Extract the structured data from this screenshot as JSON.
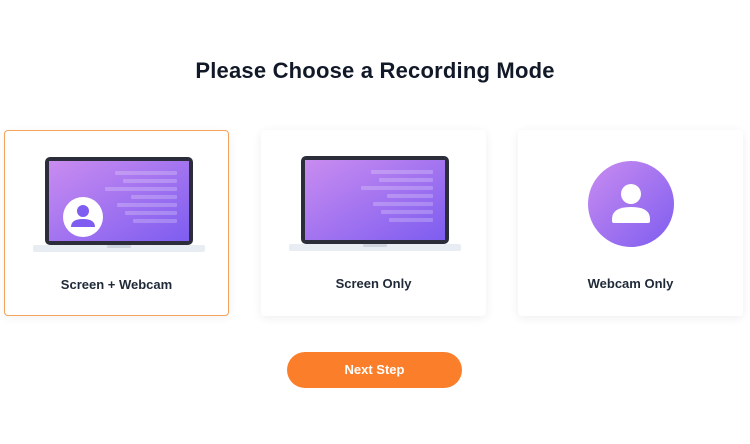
{
  "heading": "Please Choose a Recording Mode",
  "modes": [
    {
      "label": "Screen + Webcam",
      "icon": "laptop-with-webcam-icon",
      "selected": true
    },
    {
      "label": "Screen Only",
      "icon": "laptop-icon",
      "selected": false
    },
    {
      "label": "Webcam Only",
      "icon": "user-circle-icon",
      "selected": false
    }
  ],
  "next_button": "Next Step",
  "colors": {
    "accent": "#fb7f2a",
    "selected_border": "#f5a35c",
    "screen_gradient_start": "#c98cf0",
    "screen_gradient_end": "#7e5df0"
  }
}
